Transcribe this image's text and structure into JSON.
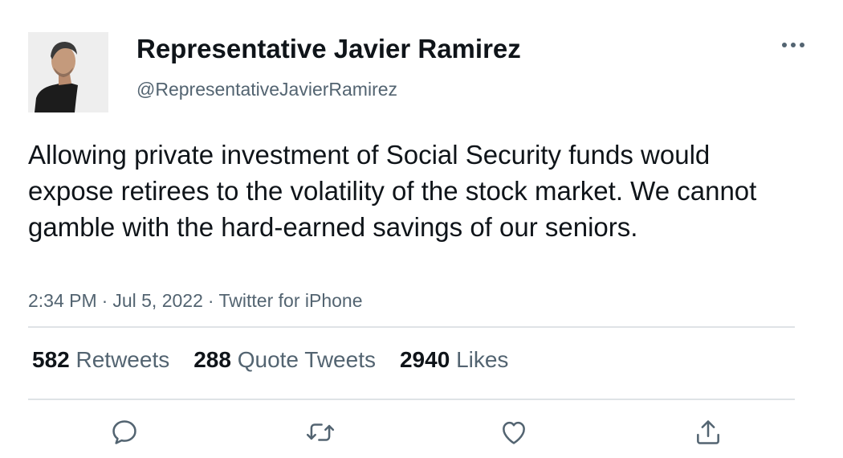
{
  "author": {
    "display_name": "Representative Javier Ramirez",
    "handle": "@RepresentativeJavierRamirez"
  },
  "tweet": {
    "text": "Allowing private investment of Social Security funds would expose retirees to the volatility of the stock market. We cannot gamble with the hard-earned savings of our seniors.",
    "time": "2:34 PM",
    "date": "Jul 5, 2022",
    "source": "Twitter for iPhone",
    "separator": "·"
  },
  "stats": {
    "retweets": {
      "count": "582",
      "label": "Retweets"
    },
    "quote_tweets": {
      "count": "288",
      "label": "Quote Tweets"
    },
    "likes": {
      "count": "2940",
      "label": "Likes"
    }
  },
  "icons": {
    "more": "more-horizontal-icon",
    "reply": "reply-icon",
    "retweet": "retweet-icon",
    "like": "heart-icon",
    "share": "share-icon"
  },
  "colors": {
    "text_primary": "#0f1419",
    "text_secondary": "#536471",
    "divider": "#dfe3e6",
    "icon": "#536471"
  }
}
